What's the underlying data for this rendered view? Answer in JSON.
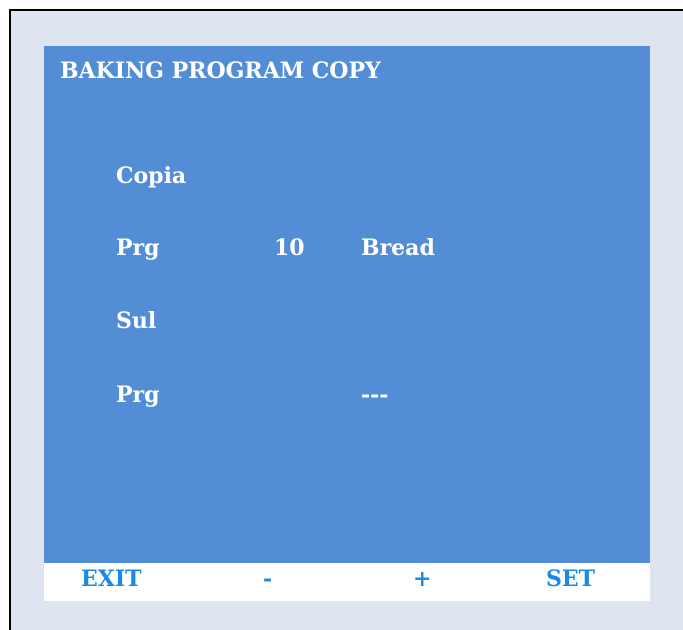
{
  "screen": {
    "title": "BAKING PROGRAM COPY",
    "rows": [
      {
        "label": "Copia",
        "number": "",
        "value": ""
      },
      {
        "label": "Prg",
        "number": "10",
        "value": "Bread"
      },
      {
        "label": "Sul",
        "number": "",
        "value": ""
      },
      {
        "label": "Prg",
        "number": "",
        "value": "---"
      }
    ]
  },
  "footer": {
    "exit_label": "EXIT",
    "minus_label": "-",
    "plus_label": "+",
    "set_label": "SET"
  },
  "colors": {
    "screen_background": "#528dd5",
    "outer_background": "#dfe4f1",
    "text": "#ffffff",
    "footer_text": "#1a8ae6"
  }
}
